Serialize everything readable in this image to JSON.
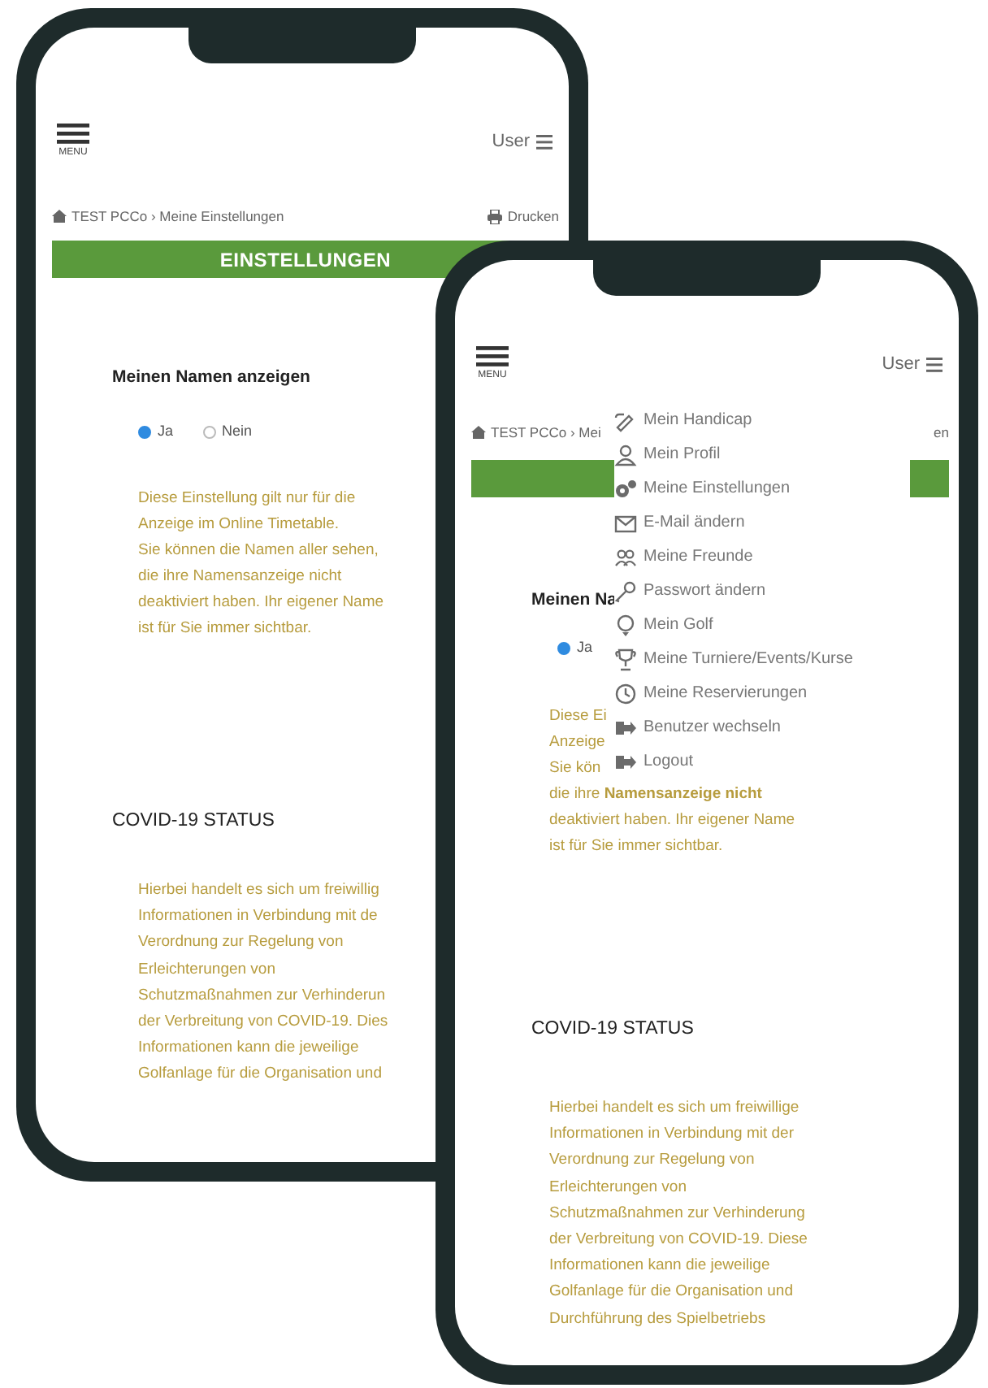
{
  "phones": [
    {
      "menu_label": "MENU",
      "user_label": "User",
      "breadcrumb": "TEST PCCo › Meine Einstellungen",
      "print_label": "Drucken",
      "section_title": "EINSTELLUNGEN",
      "setting_label": "Meinen Namen anzeigen",
      "radios": [
        {
          "label": "Ja",
          "selected": true
        },
        {
          "label": "Nein",
          "selected": false
        }
      ],
      "note_lines": [
        "Diese Einstellung gilt nur für die",
        "Anzeige im Online Timetable.",
        "Sie können die Namen aller sehen,",
        "die ihre Namensanzeige nicht",
        "deaktiviert haben. Ihr eigener Name",
        "ist für Sie immer sichtbar."
      ],
      "covid_title": "COVID-19 STATUS",
      "covid_lines": [
        "Hierbei handelt es sich um freiwillig",
        "Informationen in Verbindung mit de",
        "Verordnung zur Regelung von",
        "Erleichterungen von",
        "Schutzmaßnahmen zur Verhinderun",
        "der Verbreitung von COVID-19. Dies",
        "Informationen kann die jeweilige",
        "Golfanlage für die Organisation und"
      ]
    },
    {
      "menu_label": "MENU",
      "user_label": "User",
      "breadcrumb": "TEST PCCo › Mei",
      "print_label": "en",
      "setting_label": "Meinen Na",
      "radios": [
        {
          "label": "Ja",
          "selected": true
        }
      ],
      "note_lines": [
        "Diese Ei",
        "Anzeige",
        "Sie kön",
        "die ihre **Namensanzeige nicht**",
        "deaktiviert haben. Ihr eigener Name",
        "ist für Sie immer sichtbar."
      ],
      "covid_title": "COVID-19 STATUS",
      "covid_lines": [
        "Hierbei handelt es sich um freiwillige",
        "Informationen in Verbindung mit der",
        "Verordnung zur Regelung von",
        "Erleichterungen von",
        "Schutzmaßnahmen zur Verhinderung",
        "der Verbreitung von COVID-19. Diese",
        "Informationen kann die jeweilige",
        "Golfanlage für die Organisation und",
        "Durchführung des Spielbetriebs"
      ],
      "user_menu": [
        {
          "kind": "handicap",
          "label": "Mein Handicap"
        },
        {
          "kind": "profile",
          "label": "Mein Profil"
        },
        {
          "kind": "settings",
          "label": "Meine Einstellungen"
        },
        {
          "kind": "email",
          "label": "E-Mail ändern"
        },
        {
          "kind": "friends",
          "label": "Meine Freunde"
        },
        {
          "kind": "password",
          "label": "Passwort ändern"
        },
        {
          "kind": "golf",
          "label": "Mein Golf"
        },
        {
          "kind": "tournaments",
          "label": "Meine Turniere/Events/Kurse"
        },
        {
          "kind": "reservations",
          "label": "Meine Reservierungen"
        },
        {
          "kind": "switch",
          "label": "Benutzer wechseln"
        },
        {
          "kind": "logout",
          "label": "Logout"
        }
      ]
    }
  ]
}
